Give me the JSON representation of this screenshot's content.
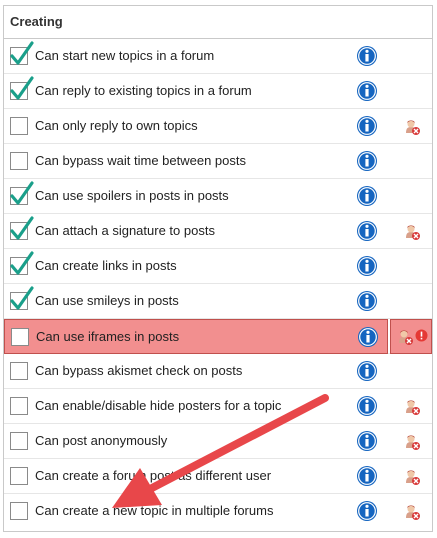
{
  "section": {
    "title": "Creating"
  },
  "permissions": [
    {
      "label": "Can start new topics in a forum",
      "checked": true,
      "user_icon": false,
      "warning": false,
      "highlighted": false
    },
    {
      "label": "Can reply to existing topics in a forum",
      "checked": true,
      "user_icon": false,
      "warning": false,
      "highlighted": false
    },
    {
      "label": "Can only reply to own topics",
      "checked": false,
      "user_icon": true,
      "warning": false,
      "highlighted": false
    },
    {
      "label": "Can bypass wait time between posts",
      "checked": false,
      "user_icon": false,
      "warning": false,
      "highlighted": false
    },
    {
      "label": "Can use spoilers in posts in posts",
      "checked": true,
      "user_icon": false,
      "warning": false,
      "highlighted": false
    },
    {
      "label": "Can attach a signature to posts",
      "checked": true,
      "user_icon": true,
      "warning": false,
      "highlighted": false
    },
    {
      "label": "Can create links in posts",
      "checked": true,
      "user_icon": false,
      "warning": false,
      "highlighted": false
    },
    {
      "label": "Can use smileys in posts",
      "checked": true,
      "user_icon": false,
      "warning": false,
      "highlighted": false
    },
    {
      "label": "Can use iframes in posts",
      "checked": false,
      "user_icon": true,
      "warning": true,
      "highlighted": true
    },
    {
      "label": "Can bypass akismet check on posts",
      "checked": false,
      "user_icon": false,
      "warning": false,
      "highlighted": false
    },
    {
      "label": "Can enable/disable hide posters for a topic",
      "checked": false,
      "user_icon": true,
      "warning": false,
      "highlighted": false
    },
    {
      "label": "Can post anonymously",
      "checked": false,
      "user_icon": true,
      "warning": false,
      "highlighted": false
    },
    {
      "label": "Can create a forum post as different user",
      "checked": false,
      "user_icon": true,
      "warning": false,
      "highlighted": false
    },
    {
      "label": "Can create a new topic in multiple forums",
      "checked": false,
      "user_icon": true,
      "warning": false,
      "highlighted": false
    }
  ],
  "colors": {
    "check": "#1a9f8a",
    "info": "#1565c0",
    "highlight": "#f28f8f",
    "arrow": "#e8474a"
  },
  "icons": {
    "info": "info-icon",
    "user": "user-restricted-icon",
    "warning": "warning-icon",
    "check": "checkmark-icon"
  }
}
